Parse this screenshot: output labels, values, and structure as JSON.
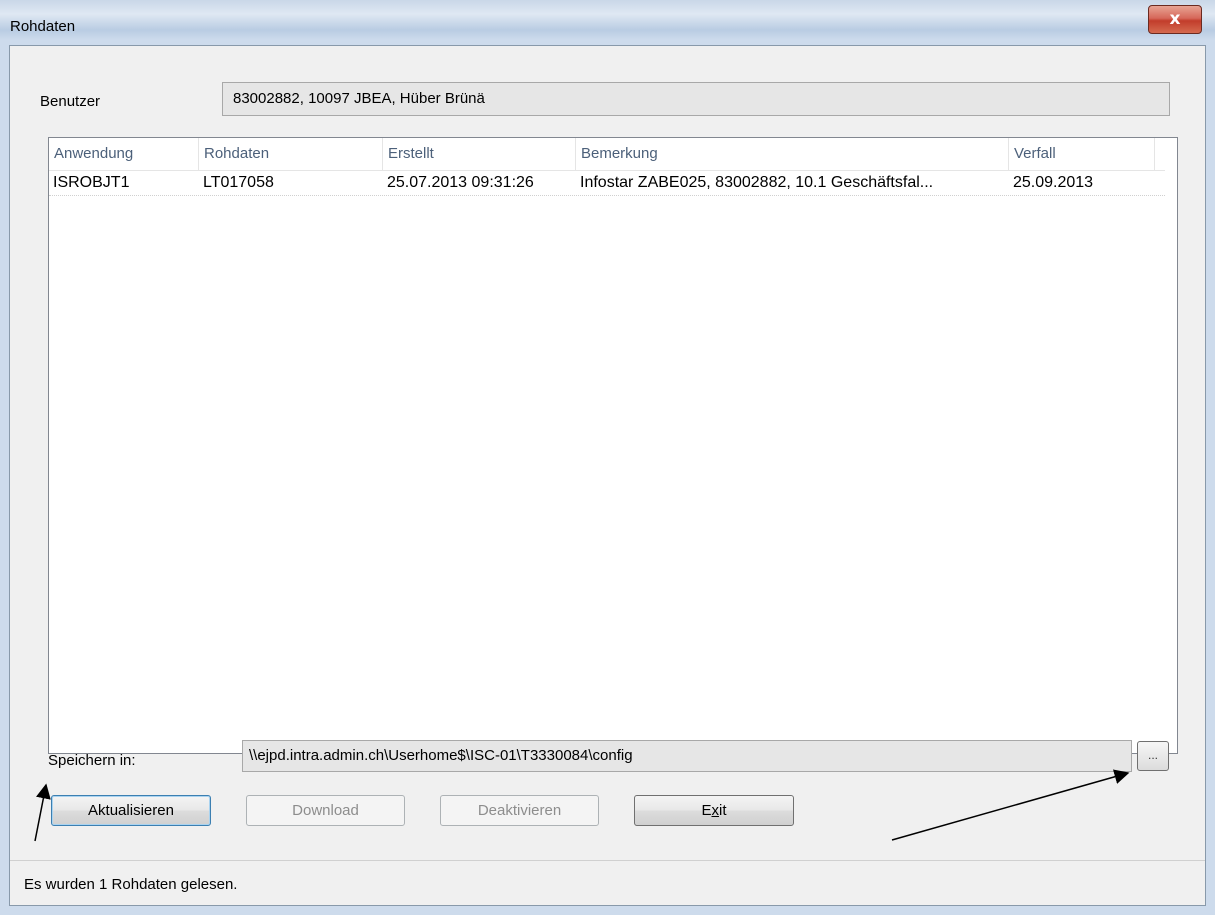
{
  "window": {
    "title": "Rohdaten",
    "close_symbol": "x"
  },
  "benutzer": {
    "label": "Benutzer",
    "value": "83002882, 10097 JBEA, Hüber Brünä"
  },
  "table": {
    "columns": [
      "Anwendung",
      "Rohdaten",
      "Erstellt",
      "Bemerkung",
      "Verfall"
    ],
    "rows": [
      [
        "ISROBJT1",
        "LT017058",
        "25.07.2013 09:31:26",
        "Infostar ZABE025, 83002882, 10.1 Geschäftsfal...",
        "25.09.2013"
      ]
    ]
  },
  "speichern": {
    "label": "Speichern in:",
    "value": "\\\\ejpd.intra.admin.ch\\Userhome$\\ISC-01\\T3330084\\config",
    "browse_label": "..."
  },
  "buttons": {
    "aktualisieren": "Aktualisieren",
    "download": "Download",
    "deaktivieren": "Deaktivieren",
    "exit_pre": "E",
    "exit_mnemonic": "x",
    "exit_post": "it"
  },
  "status": {
    "text": "Es wurden 1 Rohdaten gelesen."
  },
  "icons": {
    "close": "close-icon",
    "browse": "ellipsis-icon"
  }
}
